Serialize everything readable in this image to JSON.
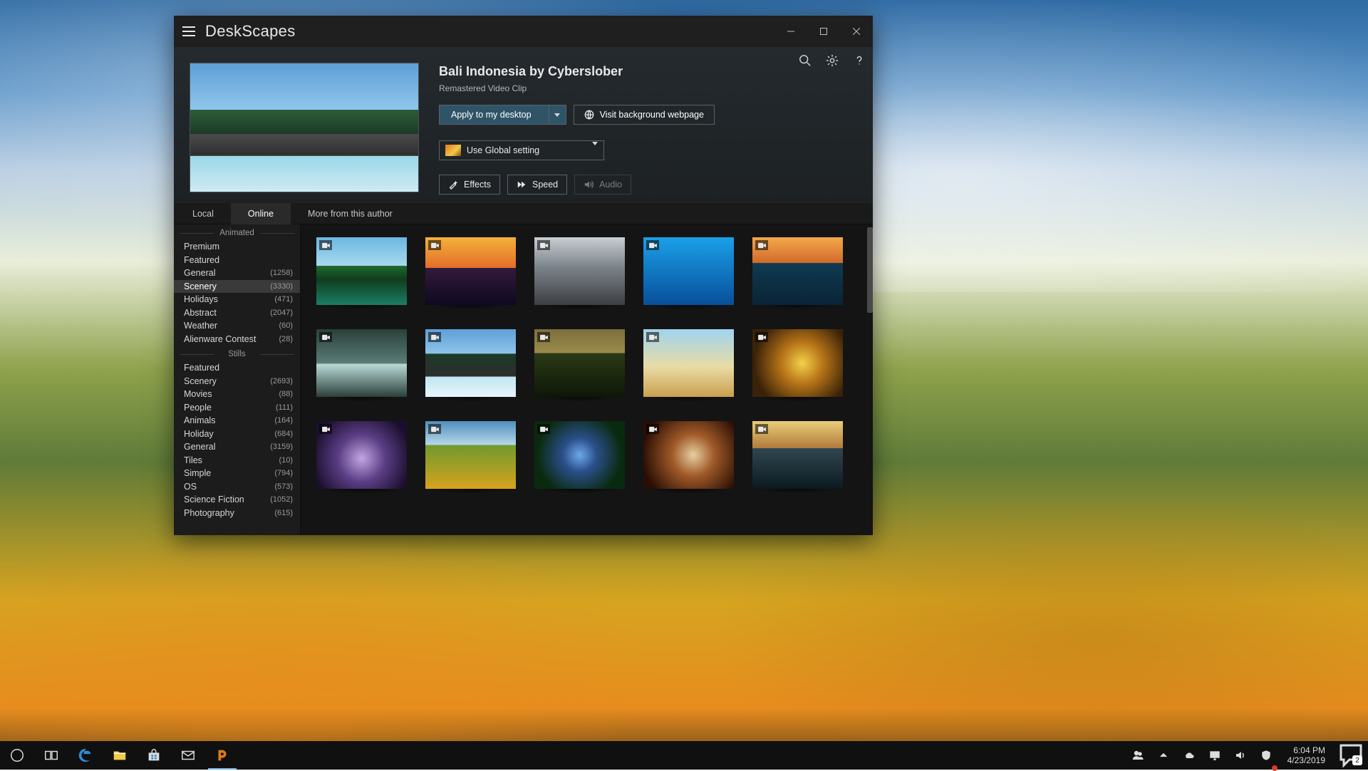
{
  "app": {
    "title": "DeskScapes"
  },
  "hero": {
    "title": "Bali Indonesia by Cyberslober",
    "subtitle": "Remastered Video Clip",
    "apply_label": "Apply to my desktop",
    "visit_label": "Visit background webpage",
    "global_setting": "Use Global setting",
    "effects": "Effects",
    "speed": "Speed",
    "audio": "Audio"
  },
  "tabs": {
    "local": "Local",
    "online": "Online",
    "more": "More from this author",
    "active": "online"
  },
  "sidebar": {
    "sections": {
      "animated_label": "Animated",
      "stills_label": "Stills"
    },
    "animated": [
      {
        "label": "Premium",
        "count": ""
      },
      {
        "label": "Featured",
        "count": ""
      },
      {
        "label": "General",
        "count": "(1258)"
      },
      {
        "label": "Scenery",
        "count": "(3330)",
        "selected": true
      },
      {
        "label": "Holidays",
        "count": "(471)"
      },
      {
        "label": "Abstract",
        "count": "(2047)"
      },
      {
        "label": "Weather",
        "count": "(60)"
      },
      {
        "label": "Alienware Contest",
        "count": "(28)"
      }
    ],
    "stills": [
      {
        "label": "Featured",
        "count": ""
      },
      {
        "label": "Scenery",
        "count": "(2693)"
      },
      {
        "label": "Movies",
        "count": "(88)"
      },
      {
        "label": "People",
        "count": "(111)"
      },
      {
        "label": "Animals",
        "count": "(164)"
      },
      {
        "label": "Holiday",
        "count": "(684)"
      },
      {
        "label": "General",
        "count": "(3159)"
      },
      {
        "label": "Tiles",
        "count": "(10)"
      },
      {
        "label": "Simple",
        "count": "(794)"
      },
      {
        "label": "OS",
        "count": "(573)"
      },
      {
        "label": "Science Fiction",
        "count": "(1052)"
      },
      {
        "label": "Photography",
        "count": "(615)"
      }
    ]
  },
  "gallery": {
    "rows": [
      [
        {
          "p": "p-lake"
        },
        {
          "p": "p-sunset"
        },
        {
          "p": "p-grey"
        },
        {
          "p": "p-blue"
        },
        {
          "p": "p-coast"
        }
      ],
      [
        {
          "p": "p-falls"
        },
        {
          "p": "p-bali"
        },
        {
          "p": "p-storm"
        },
        {
          "p": "p-beach"
        },
        {
          "p": "p-gold"
        }
      ],
      [
        {
          "p": "p-purple"
        },
        {
          "p": "p-flowers"
        },
        {
          "p": "p-bflower"
        },
        {
          "p": "p-galaxy"
        },
        {
          "p": "p-wave"
        }
      ]
    ]
  },
  "taskbar": {
    "time": "6:04 PM",
    "date": "4/23/2019",
    "notif_count": "2"
  }
}
